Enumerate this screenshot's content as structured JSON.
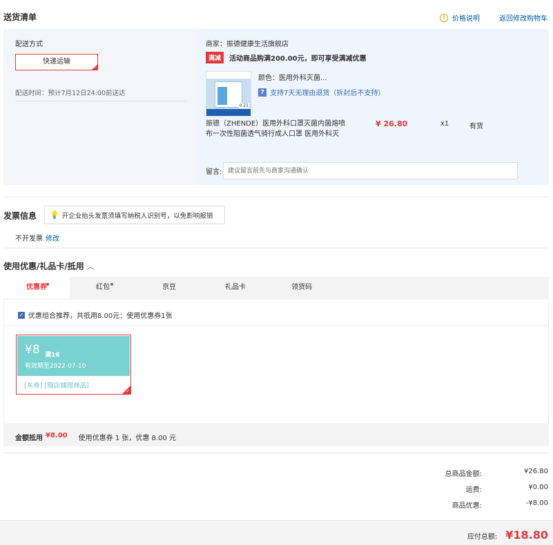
{
  "header": {
    "title": "送货清单",
    "price_note": "价格说明",
    "back_to_cart": "返回修改购物车"
  },
  "shipping": {
    "label": "配送方式",
    "method": "快递运输",
    "time": "配送时间：预计7月12日24:00前送达"
  },
  "seller": {
    "name": "商家：振德健康生活旗舰店",
    "promo_badge": "满减",
    "promo_text": "活动商品购满200.00元，即可享受满减优惠"
  },
  "product": {
    "color": "颜色：医用外科灭菌...",
    "return_badge": "7",
    "return_text": "支持7天无理由退货（拆封后不支持）",
    "name": "振德（ZHENDE）医用外科口罩灭菌内菌熔喷布一次性阻菌透气骑行成人口罩 医用外科灭",
    "price": "¥ 26.80",
    "qty": "x1",
    "stock": "有货",
    "image_tag": "0.21"
  },
  "message": {
    "label": "留言:",
    "placeholder": "建议留言前先与商家沟通确认"
  },
  "invoice": {
    "title": "发票信息",
    "tip": "开企业抬头发票须填写纳税人识别号，以免影响报销",
    "value": "不开发票",
    "edit": "修改"
  },
  "coupons": {
    "title": "使用优惠/礼品卡/抵用",
    "tabs": [
      {
        "label": "优惠券"
      },
      {
        "label": "红包"
      },
      {
        "label": "京豆"
      },
      {
        "label": "礼品卡"
      },
      {
        "label": "领货码"
      }
    ],
    "recommend": "优惠组合推荐，共抵用8.00元：使用优惠券1张",
    "card": {
      "amount": "¥8",
      "condition": "满16",
      "validity": "有效期至2022-07-10",
      "tags": "[东券] [限店铺限商品]"
    },
    "deduct_label": "金额抵用",
    "deduct_value": "¥8.00",
    "deduct_desc": "使用优惠券 1 张，优惠 8.00 元"
  },
  "summary": {
    "rows": [
      {
        "label": "总商品金额:",
        "value": "¥26.80"
      },
      {
        "label": "运费:",
        "value": "¥0.00"
      },
      {
        "label": "商品优惠:",
        "value": "-¥8.00"
      }
    ],
    "total_label": "应付总额:",
    "total_value": "¥18.80"
  },
  "colors": {
    "accent_red": "#e4393c",
    "link_blue": "#005ea7",
    "coupon_teal": "#78d2d0"
  }
}
